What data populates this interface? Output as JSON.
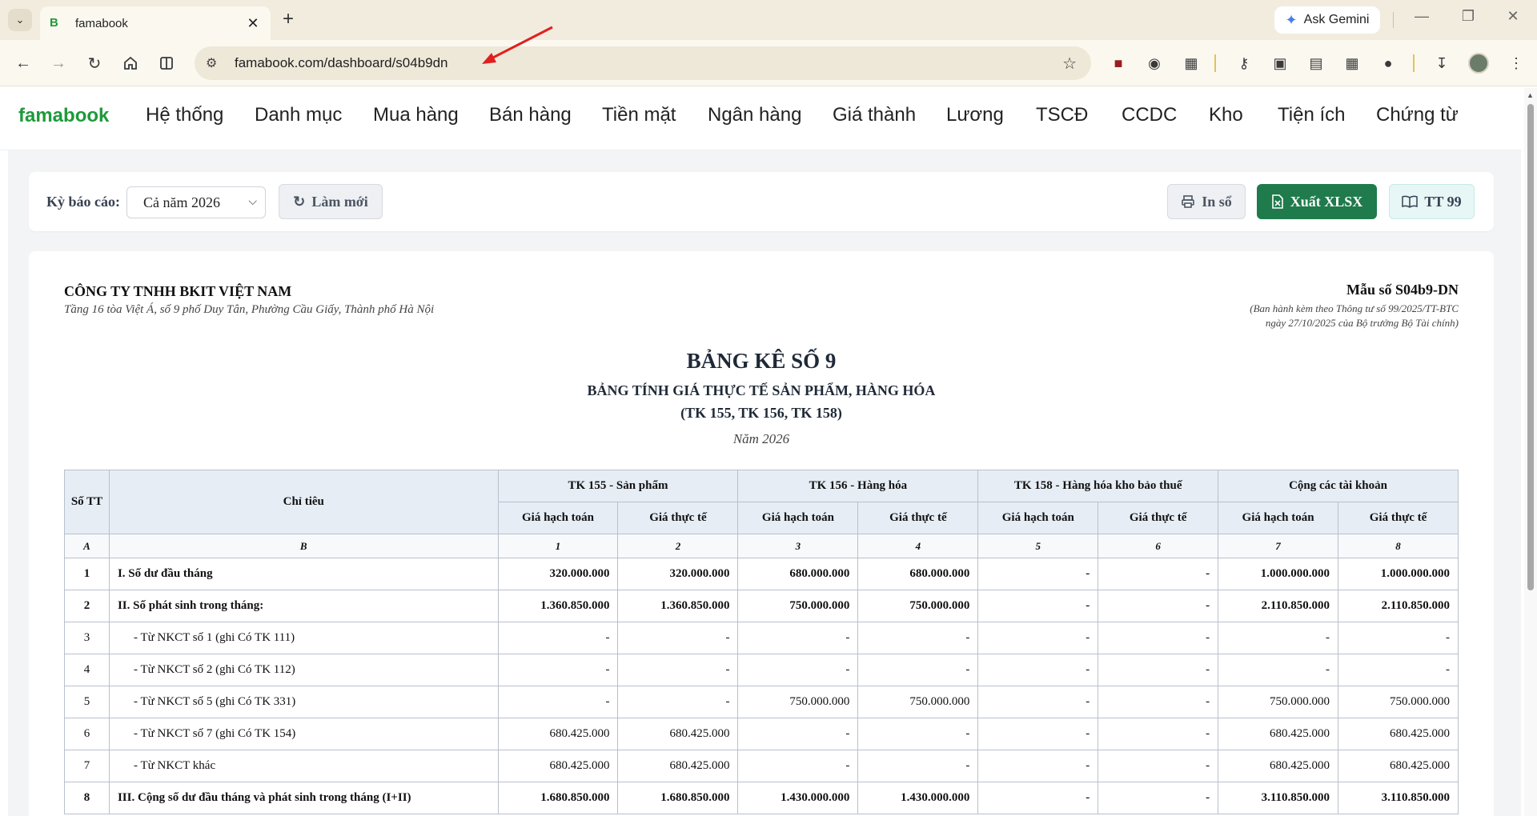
{
  "browser": {
    "tab_title": "famabook",
    "url": "famabook.com/dashboard/s04b9dn",
    "ask_gemini": "Ask Gemini"
  },
  "app": {
    "brand": "famabook",
    "brand_color": "#1e9a3a",
    "menu": [
      "Hệ thống",
      "Danh mục",
      "Mua hàng",
      "Bán hàng",
      "Tiền mặt",
      "Ngân hàng",
      "Giá thành",
      "Lương",
      "TSCĐ",
      "CCDC",
      "Kho",
      "Tiện ích",
      "Chứng từ"
    ]
  },
  "filter": {
    "period_label": "Kỳ báo cáo:",
    "period_value": "Cả năm 2026",
    "refresh_label": "Làm mới",
    "print_label": "In sổ",
    "export_label": "Xuất XLSX",
    "circular_label": "TT 99",
    "export_color": "#1f7a4c"
  },
  "report": {
    "company": "CÔNG TY TNHH BKIT VIỆT NAM",
    "address": "Tầng 16 tòa Việt Á, số 9 phố Duy Tân, Phường Cầu Giấy, Thành phố Hà Nội",
    "form_code": "Mẫu số S04b9-DN",
    "form_note_1": "(Ban hành kèm theo Thông tư số 99/2025/TT-BTC",
    "form_note_2": "ngày 27/10/2025 của Bộ trưởng Bộ Tài chính)",
    "title": "BẢNG KÊ SỐ 9",
    "subtitle": "BẢNG TÍNH GIÁ THỰC TẾ SẢN PHẨM, HÀNG HÓA",
    "accounts": "(TK 155, TK 156, TK 158)",
    "year": "Năm 2026",
    "table": {
      "col_no": "Số TT",
      "col_label": "Chỉ tiêu",
      "groups": [
        "TK 155 - Sản phẩm",
        "TK 156 - Hàng hóa",
        "TK 158 - Hàng hóa kho bảo thuế",
        "Cộng các tài khoản"
      ],
      "sub_headers": [
        "Giá hạch toán",
        "Giá thực tế",
        "Giá hạch toán",
        "Giá thực tế",
        "Giá hạch toán",
        "Giá thực tế",
        "Giá hạch toán",
        "Giá thực tế"
      ],
      "index_row": [
        "A",
        "B",
        "1",
        "2",
        "3",
        "4",
        "5",
        "6",
        "7",
        "8"
      ],
      "rows": [
        {
          "no": "1",
          "label": "I. Số dư đầu tháng",
          "values": [
            "320.000.000",
            "320.000.000",
            "680.000.000",
            "680.000.000",
            "-",
            "-",
            "1.000.000.000",
            "1.000.000.000"
          ]
        },
        {
          "no": "2",
          "label": "II. Số phát sinh trong tháng:",
          "values": [
            "1.360.850.000",
            "1.360.850.000",
            "750.000.000",
            "750.000.000",
            "-",
            "-",
            "2.110.850.000",
            "2.110.850.000"
          ]
        },
        {
          "no": "3",
          "label": "- Từ NKCT số 1 (ghi Có TK 111)",
          "values": [
            "-",
            "-",
            "-",
            "-",
            "-",
            "-",
            "-",
            "-"
          ]
        },
        {
          "no": "4",
          "label": "- Từ NKCT số 2 (ghi Có TK 112)",
          "values": [
            "-",
            "-",
            "-",
            "-",
            "-",
            "-",
            "-",
            "-"
          ]
        },
        {
          "no": "5",
          "label": "- Từ NKCT số 5 (ghi Có TK 331)",
          "values": [
            "-",
            "-",
            "750.000.000",
            "750.000.000",
            "-",
            "-",
            "750.000.000",
            "750.000.000"
          ]
        },
        {
          "no": "6",
          "label": "- Từ NKCT số 7 (ghi Có TK 154)",
          "values": [
            "680.425.000",
            "680.425.000",
            "-",
            "-",
            "-",
            "-",
            "680.425.000",
            "680.425.000"
          ]
        },
        {
          "no": "7",
          "label": "- Từ NKCT khác",
          "values": [
            "680.425.000",
            "680.425.000",
            "-",
            "-",
            "-",
            "-",
            "680.425.000",
            "680.425.000"
          ]
        },
        {
          "no": "8",
          "label": "III. Cộng số dư đầu tháng và phát sinh trong tháng (I+II)",
          "values": [
            "1.680.850.000",
            "1.680.850.000",
            "1.430.000.000",
            "1.430.000.000",
            "-",
            "-",
            "3.110.850.000",
            "3.110.850.000"
          ]
        }
      ]
    }
  }
}
